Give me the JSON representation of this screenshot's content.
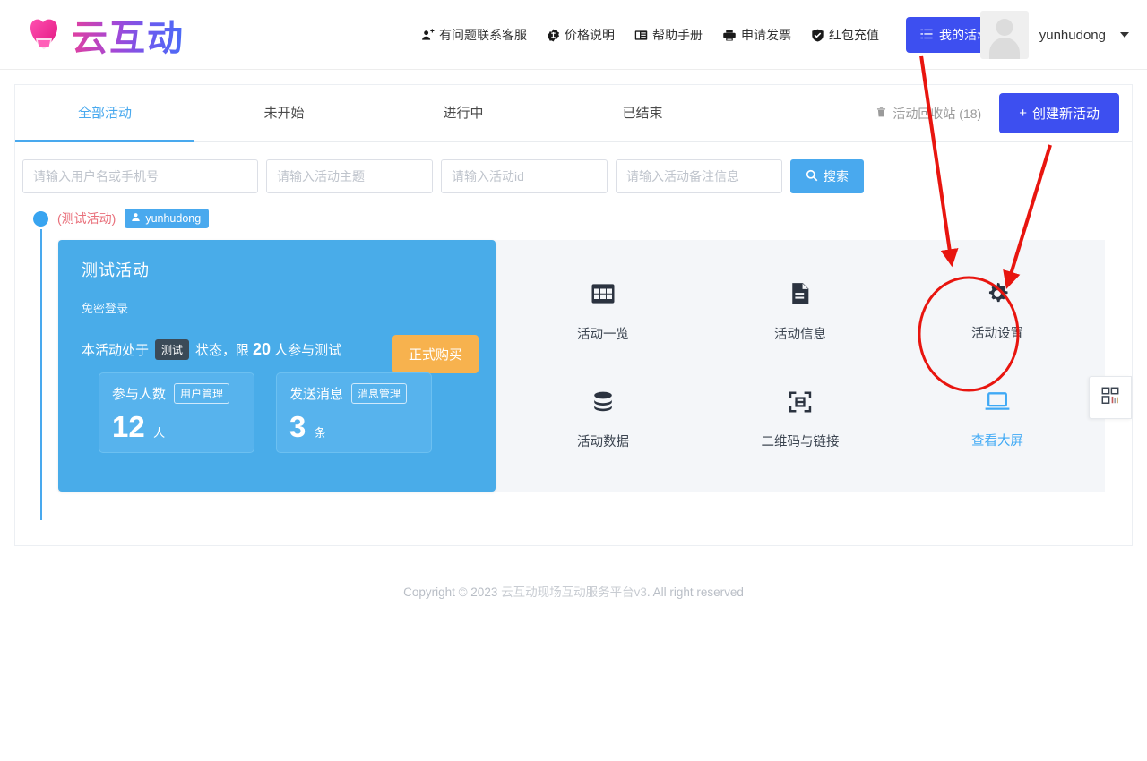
{
  "header": {
    "logo_text": "云互动",
    "nav": [
      {
        "icon": "user-plus-icon",
        "label": "有问题联系客服"
      },
      {
        "icon": "price-tag-icon",
        "label": "价格说明"
      },
      {
        "icon": "book-icon",
        "label": "帮助手册"
      },
      {
        "icon": "printer-icon",
        "label": "申请发票"
      },
      {
        "icon": "shield-check-icon",
        "label": "红包充值"
      }
    ],
    "primary_button": {
      "icon": "list-icon",
      "label": "我的活动"
    },
    "username": "yunhudong"
  },
  "tabs": [
    {
      "label": "全部活动",
      "active": true
    },
    {
      "label": "未开始",
      "active": false
    },
    {
      "label": "进行中",
      "active": false
    },
    {
      "label": "已结束",
      "active": false
    }
  ],
  "tab_right": {
    "recycle_label": "活动回收站 (18)",
    "recycle_icon": "trash-icon",
    "create_label": "创建新活动",
    "create_prefix": "+"
  },
  "search": {
    "fields": [
      {
        "placeholder": "请输入用户名或手机号",
        "value": ""
      },
      {
        "placeholder": "请输入活动主题",
        "value": ""
      },
      {
        "placeholder": "请输入活动id",
        "value": ""
      },
      {
        "placeholder": "请输入活动备注信息",
        "value": ""
      }
    ],
    "button_label": "搜索",
    "button_icon": "search-icon"
  },
  "activity": {
    "tag_name": "(测试活动)",
    "owner": "yunhudong",
    "owner_icon": "user-icon",
    "title": "测试活动",
    "subtitle": "免密登录",
    "status_prefix": "本活动处于",
    "status_chip": "测试",
    "status_mid": "状态，限",
    "status_limit": "20",
    "status_suffix": "人参与测试",
    "buy_button": "正式购买",
    "stats": [
      {
        "label": "参与人数",
        "action": "用户管理",
        "value": "12",
        "unit": "人"
      },
      {
        "label": "发送消息",
        "action": "消息管理",
        "value": "3",
        "unit": "条"
      }
    ],
    "actions": [
      {
        "icon": "grid-icon",
        "label": "活动一览",
        "highlight": false
      },
      {
        "icon": "document-icon",
        "label": "活动信息",
        "highlight": false
      },
      {
        "icon": "gear-icon",
        "label": "活动设置",
        "highlight": false,
        "annotated": true
      },
      {
        "icon": "database-icon",
        "label": "活动数据",
        "highlight": false
      },
      {
        "icon": "qrcode-scan-icon",
        "label": "二维码与链接",
        "highlight": false
      },
      {
        "icon": "laptop-icon",
        "label": "查看大屏",
        "highlight": true
      }
    ]
  },
  "float_tab": {
    "icon": "dashboard-grid-icon"
  },
  "footer": {
    "prefix": "Copyright © 2023 ",
    "brand": "云互动现场互动服务平台v3",
    "suffix": ". All right reserved"
  },
  "colors": {
    "brand_blue": "#3d4ff0",
    "accent_blue": "#49a9ee",
    "card_blue": "#49ace9",
    "orange": "#f7b24e",
    "annotation_red": "#e8150f",
    "tag_red": "#e9707b"
  }
}
